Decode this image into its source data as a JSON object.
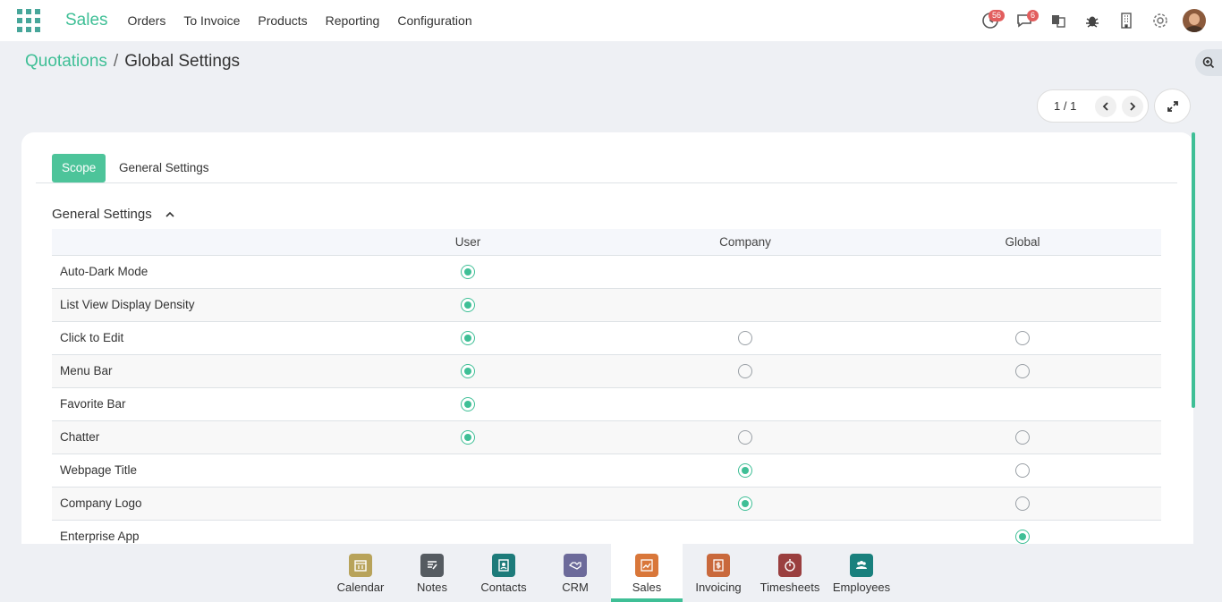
{
  "topbar": {
    "app_name": "Sales",
    "menu": [
      "Orders",
      "To Invoice",
      "Products",
      "Reporting",
      "Configuration"
    ],
    "activity_badge": "56",
    "messages_badge": "6",
    "icons": [
      "clock-icon",
      "chat-icon",
      "translate-icon",
      "bug-icon",
      "building-icon",
      "gear-icon",
      "avatar"
    ]
  },
  "breadcrumb": {
    "parent": "Quotations",
    "separator": "/",
    "current": "Global Settings"
  },
  "pager": {
    "value": "1 / 1"
  },
  "tabs": [
    {
      "label": "Scope",
      "active": true
    },
    {
      "label": "General Settings",
      "active": false
    }
  ],
  "group": {
    "title": "General Settings"
  },
  "table": {
    "columns": [
      "User",
      "Company",
      "Global"
    ],
    "rows": [
      {
        "label": "Auto-Dark Mode",
        "user": "selected",
        "company": "none",
        "global": "none"
      },
      {
        "label": "List View Display Density",
        "user": "selected",
        "company": "none",
        "global": "none"
      },
      {
        "label": "Click to Edit",
        "user": "selected",
        "company": "unselected",
        "global": "unselected"
      },
      {
        "label": "Menu Bar",
        "user": "selected",
        "company": "unselected",
        "global": "unselected"
      },
      {
        "label": "Favorite Bar",
        "user": "selected",
        "company": "none",
        "global": "none"
      },
      {
        "label": "Chatter",
        "user": "selected",
        "company": "unselected",
        "global": "unselected"
      },
      {
        "label": "Webpage Title",
        "user": "none",
        "company": "selected",
        "global": "unselected"
      },
      {
        "label": "Company Logo",
        "user": "none",
        "company": "selected",
        "global": "unselected"
      },
      {
        "label": "Enterprise App",
        "user": "none",
        "company": "none",
        "global": "selected"
      }
    ]
  },
  "dock": [
    {
      "label": "Calendar",
      "color": "#b8a35a",
      "icon": "calendar-icon",
      "active": false
    },
    {
      "label": "Notes",
      "color": "#555b61",
      "icon": "notes-icon",
      "active": false
    },
    {
      "label": "Contacts",
      "color": "#1d7b7a",
      "icon": "contacts-icon",
      "active": false
    },
    {
      "label": "CRM",
      "color": "#6c6a9a",
      "icon": "handshake-icon",
      "active": false
    },
    {
      "label": "Sales",
      "color": "#d9773a",
      "icon": "sales-chart-icon",
      "active": true
    },
    {
      "label": "Invoicing",
      "color": "#c9693c",
      "icon": "invoice-icon",
      "active": false
    },
    {
      "label": "Timesheets",
      "color": "#9a3f3f",
      "icon": "stopwatch-icon",
      "active": false
    },
    {
      "label": "Employees",
      "color": "#19807d",
      "icon": "employees-icon",
      "active": false
    }
  ],
  "colors": {
    "accent": "#3fbf96",
    "badge": "#e25d5d"
  }
}
